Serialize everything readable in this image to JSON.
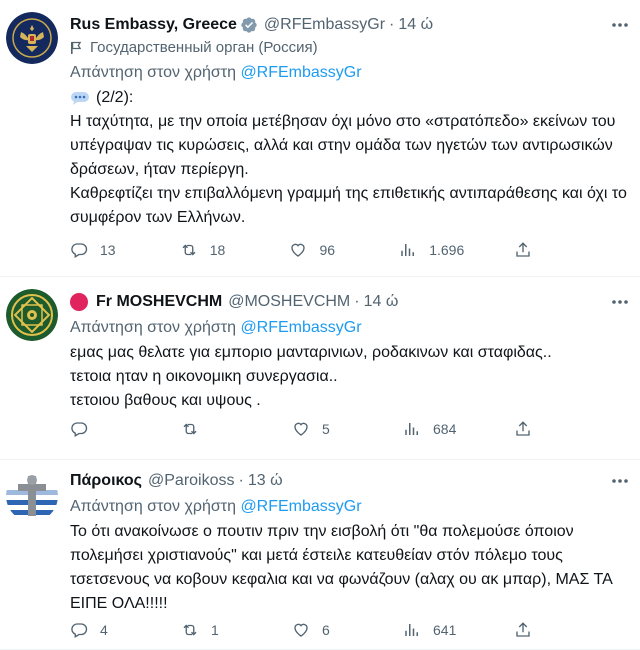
{
  "colors": {
    "link": "#1d9bf0",
    "muted": "#536471",
    "text": "#0f1419",
    "verified": "#829aab",
    "red_dot": "#e0245e"
  },
  "tweets": [
    {
      "name": "Rus Embassy, Greece",
      "handle": "@RFEmbassyGr",
      "dot": "·",
      "time": "14 ώ",
      "affiliation": "Государственный орган (Россия)",
      "reply_prefix": "Απάντηση στον χρήστη",
      "reply_mention": "@RFEmbassyGr",
      "text_lead": "(2/2):",
      "text": "Η ταχύτητα, με την οποία μετέβησαν όχι μόνο στο «στρατόπεδο» εκείνων του υπέγραψαν τις κυρώσεις, αλλά και στην ομάδα των ηγετών των αντιρωσικών δράσεων, ήταν περίεργη.\nΚαθρεφτίζει την επιβαλλόμενη γραμμή της επιθετικής αντιπαράθεσης και όχι το συμφέρον των Ελλήνων.",
      "stats": {
        "replies": "13",
        "retweets": "18",
        "likes": "96",
        "views": "1.696"
      }
    },
    {
      "name": "Fr MOSHEVCHM",
      "handle": "@MOSHEVCHM",
      "dot": "·",
      "time": "14 ώ",
      "reply_prefix": "Απάντηση στον χρήστη",
      "reply_mention": "@RFEmbassyGr",
      "text": "εμας μας θελατε για εμποριο μανταρινιων, ροδακινων και σταφιδας..\nτετοια ηταν η οικονομικη συνεργασια..\nτετοιου βαθους και υψους .",
      "stats": {
        "replies": "",
        "retweets": "",
        "likes": "5",
        "views": "684"
      }
    },
    {
      "name": "Πάροικος",
      "handle": "@Paroikoss",
      "dot": "·",
      "time": "13 ώ",
      "reply_prefix": "Απάντηση στον χρήστη",
      "reply_mention": "@RFEmbassyGr",
      "text": "Το ότι ανακοίνωσε ο πουτιν πριν την εισβολή ότι \"θα πολεμούσε όποιον πολεμήσει χριστιανούς\" και μετά έστειλε κατευθείαν στόν πόλεμο τους τσετσενους να κοβουν κεφαλια και να  φωνάζουν (αλαχ ου ακ μπαρ), ΜΑΣ ΤΑ ΕΙΠΕ ΟΛΑ!!!!!",
      "stats": {
        "replies": "4",
        "retweets": "1",
        "likes": "6",
        "views": "641"
      }
    }
  ]
}
